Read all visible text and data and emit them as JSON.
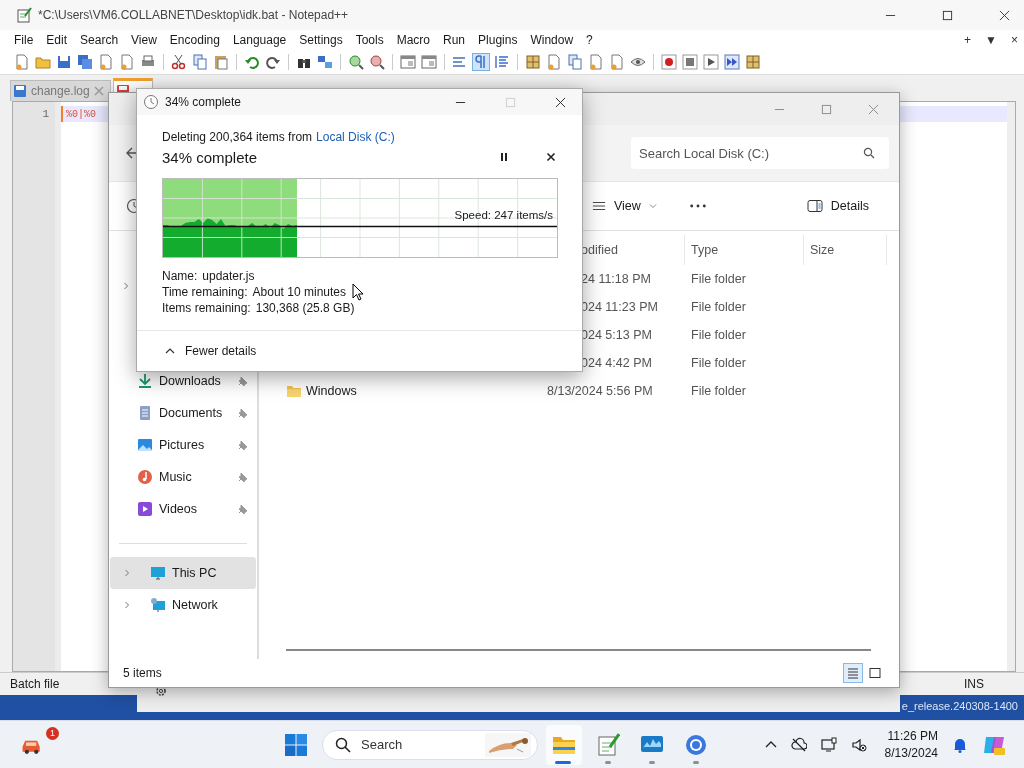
{
  "notepad": {
    "title": "*C:\\Users\\VM6.COLLABNET\\Desktop\\idk.bat - Notepad++",
    "menu": [
      "File",
      "Edit",
      "Search",
      "View",
      "Encoding",
      "Language",
      "Settings",
      "Tools",
      "Macro",
      "Run",
      "Plugins",
      "Window",
      "?"
    ],
    "menu_controls": [
      "+",
      "▼",
      "×"
    ],
    "tabs": [
      {
        "label": "change.log",
        "selected": false
      },
      {
        "selected": true
      }
    ],
    "line_numbers": [
      "1"
    ],
    "code": "%0|%0",
    "status_bar": {
      "file_type": "Batch file",
      "mode": "INS"
    }
  },
  "desktop": {
    "watermark": "e_release.240308-1400"
  },
  "explorer": {
    "search_placeholder": "Search Local Disk (C:)",
    "toolbar": {
      "view": "View",
      "details": "Details"
    },
    "columns": [
      "odified",
      "Type",
      "Size"
    ],
    "rows": [
      {
        "modified": "24 11:18 PM",
        "type": "File folder"
      },
      {
        "modified": "024 11:23 PM",
        "type": "File folder"
      },
      {
        "modified": "024 5:13 PM",
        "type": "File folder"
      },
      {
        "modified": "024 4:42 PM",
        "type": "File folder"
      },
      {
        "name": "Windows",
        "modified": "8/13/2024 5:56 PM",
        "type": "File folder"
      }
    ],
    "sidebar": [
      {
        "label": "Downloads",
        "kind": "downloads",
        "pinned": true,
        "selected": false
      },
      {
        "label": "Documents",
        "kind": "documents",
        "pinned": true,
        "selected": false
      },
      {
        "label": "Pictures",
        "kind": "pictures",
        "pinned": true,
        "selected": false
      },
      {
        "label": "Music",
        "kind": "music",
        "pinned": true,
        "selected": false
      },
      {
        "label": "Videos",
        "kind": "videos",
        "pinned": true,
        "selected": false
      },
      {
        "label": "This PC",
        "kind": "pc",
        "pinned": false,
        "selected": true
      },
      {
        "label": "Network",
        "kind": "network",
        "pinned": false,
        "selected": false
      }
    ],
    "status": "5 items",
    "view_modes": [
      {
        "kind": "details",
        "selected": true
      },
      {
        "kind": "tiles",
        "selected": false
      }
    ]
  },
  "dialog": {
    "title": "34% complete",
    "message": "Deleting 200,364 items from",
    "link": "Local Disk (C:)",
    "heading": "34% complete",
    "window_buttons": [
      {
        "kind": "minimize",
        "disabled": false
      },
      {
        "kind": "maximize",
        "disabled": true
      },
      {
        "kind": "close",
        "disabled": false
      }
    ],
    "graph": {
      "level": 0.34,
      "speed": "Speed: 247 items/s"
    },
    "details": [
      {
        "label": "Name:",
        "value": "updater.js"
      },
      {
        "label": "Time remaining:",
        "value": "About 10 minutes"
      },
      {
        "label": "Items remaining:",
        "value": "130,368 (25.8 GB)"
      }
    ],
    "toggle": "Fewer details"
  },
  "taskbar": {
    "badge": "1",
    "search": "Search",
    "apps": [
      {
        "kind": "explorer",
        "active": true
      },
      {
        "kind": "notepad",
        "active": false
      },
      {
        "kind": "monitor",
        "active": false
      },
      {
        "kind": "browser",
        "active": false
      }
    ],
    "time": "11:26 PM",
    "date": "8/13/2024"
  }
}
